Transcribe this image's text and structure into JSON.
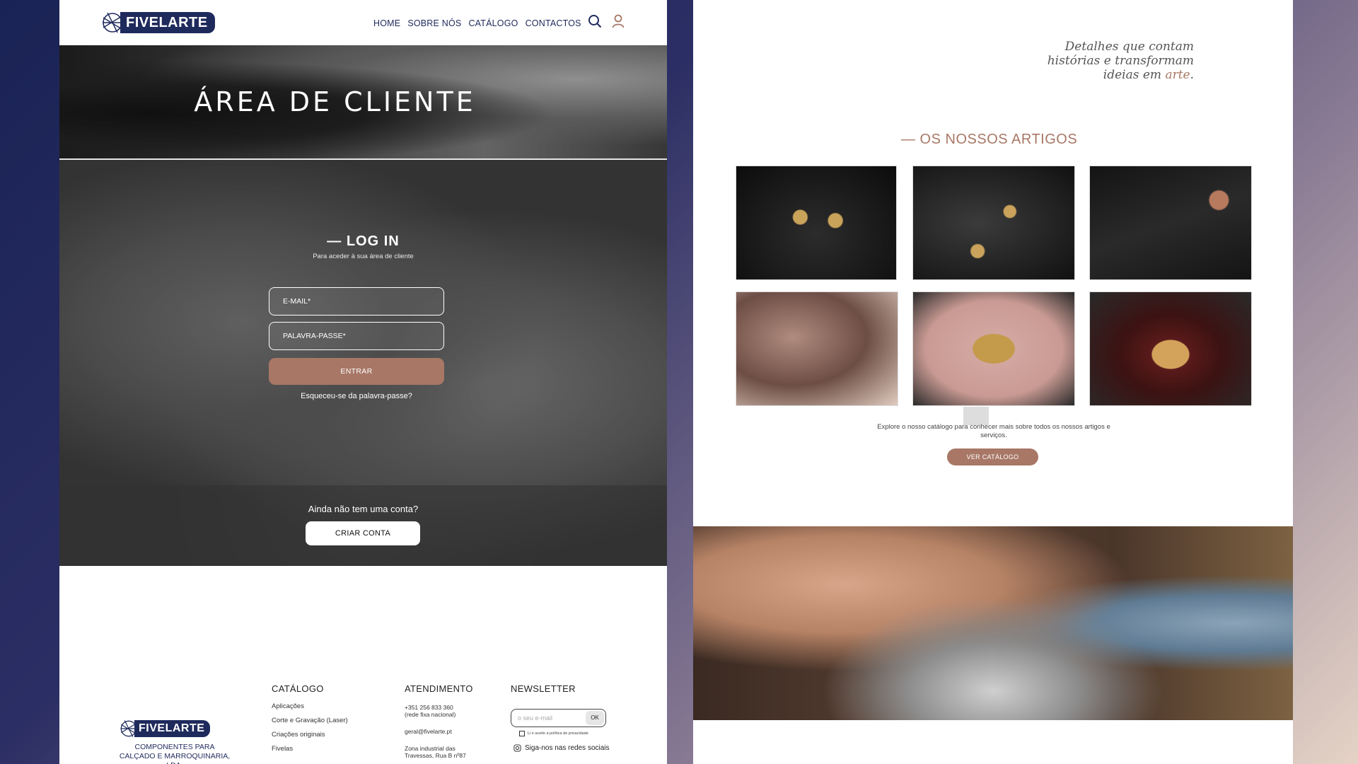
{
  "left": {
    "brand": "FIVELARTE",
    "nav": [
      "HOME",
      "SOBRE NÓS",
      "CATÁLOGO",
      "CONTACTOS"
    ],
    "banner_title": "ÁREA DE CLIENTE",
    "login": {
      "title": "— LOG IN",
      "subtitle": "Para aceder à sua área de cliente",
      "email_placeholder": "E-MAIL*",
      "password_placeholder": "PALAVRA-PASSE*",
      "submit_label": "ENTRAR",
      "forgot_label": "Esqueceu-se da palavra-passe?"
    },
    "no_account": {
      "question": "Ainda não tem uma conta?",
      "create_label": "CRIAR CONTA"
    },
    "footer": {
      "brand": "FIVELARTE",
      "tagline": "COMPONENTES PARA CALÇADO E MARROQUINARIA, LDA.",
      "catalog": {
        "heading": "CATÁLOGO",
        "items": [
          "Aplicações",
          "Corte e Gravação (Laser)",
          "Criações originais",
          "Fivelas"
        ]
      },
      "service": {
        "heading": "ATENDIMENTO",
        "phone": "+351 256 833 360",
        "phone_note": "(rede fixa nacional)",
        "email": "geral@fivelarte.pt",
        "address_1": "Zona industrial das",
        "address_2": "Travessas, Rua B nº87"
      },
      "newsletter": {
        "heading": "NEWSLETTER",
        "placeholder": "o seu e-mail",
        "ok_label": "OK",
        "privacy_label": "Li e aceito a política de privacidade",
        "social_label": "Siga-nos nas redes sociais"
      }
    }
  },
  "right": {
    "quote_1": "Detalhes que contam",
    "quote_2": "histórias e transformam",
    "quote_3a": "ideias em ",
    "quote_3b": "arte",
    "quote_3c": ".",
    "section_title": "— OS NOSSOS ARTIGOS",
    "explore_text": "Explore o nosso catálogo para conhecer mais sobre todos os nossos artigos e serviços.",
    "cta_label": "VER CATÁLOGO"
  },
  "colors": {
    "brand_navy": "#1f2a5c",
    "accent_copper": "#a87766"
  }
}
